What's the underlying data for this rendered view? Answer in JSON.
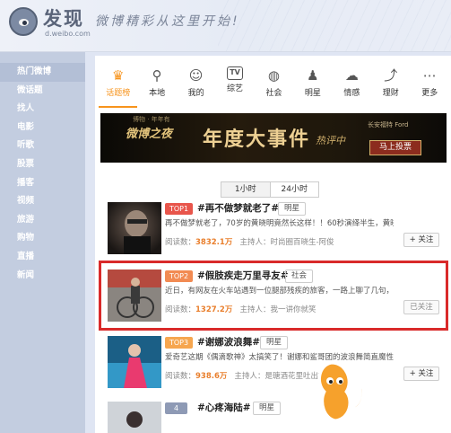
{
  "header": {
    "logo_title": "发现",
    "logo_subtitle": "d.weibo.com",
    "slogan": "微博精彩从这里开始!"
  },
  "sidebar": {
    "items": [
      {
        "label": "热门微博"
      },
      {
        "label": "微话题"
      },
      {
        "label": "找人"
      },
      {
        "label": "电影"
      },
      {
        "label": "听歌"
      },
      {
        "label": "股票"
      },
      {
        "label": "播客"
      },
      {
        "label": "视频"
      },
      {
        "label": "旅游"
      },
      {
        "label": "购物"
      },
      {
        "label": "直播"
      },
      {
        "label": "新闻"
      }
    ]
  },
  "categories": [
    {
      "label": "话题榜",
      "icon": "trophy-icon",
      "glyph": "♛"
    },
    {
      "label": "本地",
      "icon": "location-pin-icon",
      "glyph": "⚲"
    },
    {
      "label": "我的",
      "icon": "person-icon",
      "glyph": "☺"
    },
    {
      "label": "综艺",
      "icon": "tv-icon",
      "glyph": "TV"
    },
    {
      "label": "社会",
      "icon": "globe-icon",
      "glyph": "◍"
    },
    {
      "label": "明星",
      "icon": "star-person-icon",
      "glyph": "♟"
    },
    {
      "label": "情感",
      "icon": "cloud-heart-icon",
      "glyph": "☁"
    },
    {
      "label": "理财",
      "icon": "chart-icon",
      "glyph": "⤴"
    },
    {
      "label": "更多",
      "icon": "more-icon",
      "glyph": "⋯"
    }
  ],
  "banner": {
    "top_text": "博物 · 年年有",
    "left_text": "微博之夜",
    "main_text": "年度大事件",
    "side_text": "热评中",
    "brand_text": "长安福特 Ford",
    "button_label": "马上投票"
  },
  "tabs": [
    {
      "label": "1小时"
    },
    {
      "label": "24小时"
    }
  ],
  "entries": [
    {
      "rank": "TOP1",
      "rank_color": "#e8554b",
      "title": "#再不做梦就老了#",
      "tag": "明星",
      "desc": "再不做梦就老了，70岁的黄晓明竟然长这样！！60秒演绎半生，黄晓明用7...",
      "reads_label": "阅读数：",
      "reads": "3832.1万",
      "host_label": "主持人：",
      "host": "时尚圈百晓生-阿俊",
      "follow_label": "+ 关注"
    },
    {
      "rank": "TOP2",
      "rank_color": "#f28b53",
      "title": "#假肢疾走万里寻友#",
      "tag": "社会",
      "desc": "近日，有网友在火车站遇到一位腿部残疾的旅客，一路上聊了几句，发现...",
      "reads_label": "阅读数：",
      "reads": "1327.2万",
      "host_label": "主持人：",
      "host": "我一讲你就笑",
      "follow_label": "已关注"
    },
    {
      "rank": "TOP3",
      "rank_color": "#f6a64f",
      "title": "#谢娜波浪舞#",
      "tag": "明星",
      "desc": "爱奇艺这期《偶滴歌神》太搞笑了！谢娜和鲨哥团的波浪舞简直魔性",
      "reads_label": "阅读数：",
      "reads": "938.6万",
      "host_label": "主持人：",
      "host": "是瑭酒花里吐出的野马",
      "follow_label": "+ 关注"
    },
    {
      "rank": "4",
      "rank_color": "#8e9ab5",
      "title": "#心疼海陆#",
      "tag": "明星",
      "desc": "",
      "reads_label": "",
      "reads": "",
      "host_label": "",
      "host": "",
      "follow_label": ""
    }
  ],
  "watermark": {
    "text": "九游"
  },
  "colors": {
    "accent": "#f7941d",
    "highlight_border": "#d92a2a",
    "sidebar_bg": "#c3cde0"
  }
}
